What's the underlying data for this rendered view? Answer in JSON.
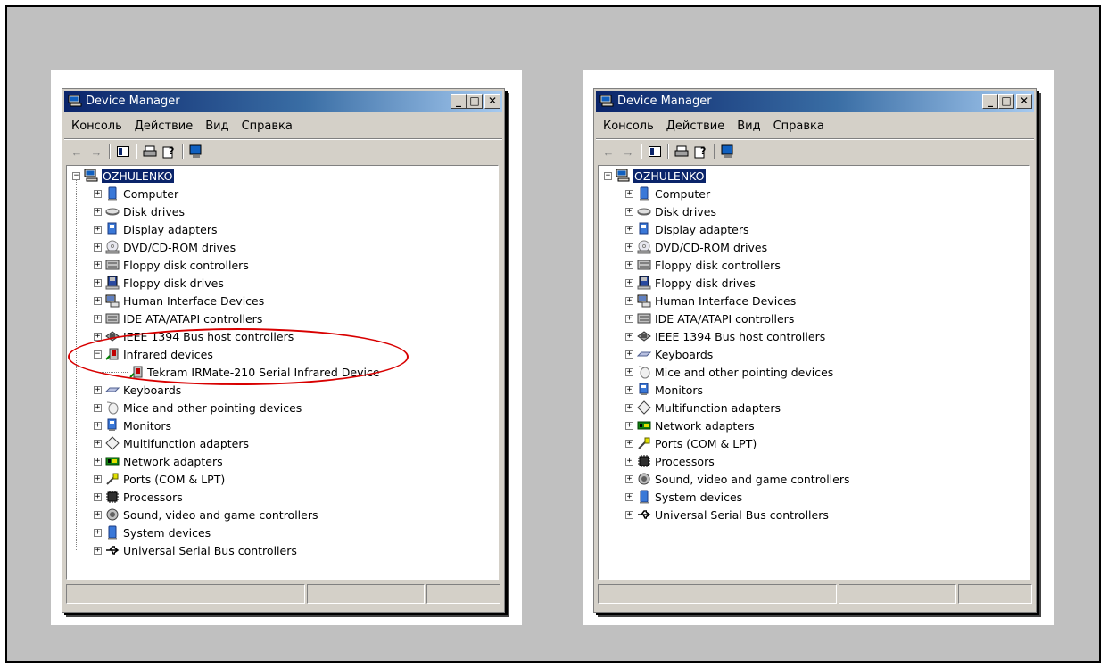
{
  "windows": [
    {
      "title": "Device Manager",
      "menu": [
        "Консоль",
        "Действие",
        "Вид",
        "Справка"
      ],
      "tree": {
        "root": "OZHULENKO",
        "items": [
          {
            "label": "Computer",
            "icon": "computer-icon"
          },
          {
            "label": "Disk drives",
            "icon": "disk-drive-icon"
          },
          {
            "label": "Display adapters",
            "icon": "display-adapter-icon"
          },
          {
            "label": "DVD/CD-ROM drives",
            "icon": "dvd-drive-icon"
          },
          {
            "label": "Floppy disk controllers",
            "icon": "controller-icon"
          },
          {
            "label": "Floppy disk drives",
            "icon": "floppy-drive-icon"
          },
          {
            "label": "Human Interface Devices",
            "icon": "hid-icon"
          },
          {
            "label": "IDE ATA/ATAPI controllers",
            "icon": "controller-icon"
          },
          {
            "label": "IEEE 1394 Bus host controllers",
            "icon": "ieee1394-icon"
          },
          {
            "label": "Infrared devices",
            "icon": "infrared-icon",
            "expanded": true,
            "children": [
              {
                "label": "Tekram IRMate-210 Serial Infrared Device",
                "icon": "infrared-icon"
              }
            ]
          },
          {
            "label": "Keyboards",
            "icon": "keyboard-icon"
          },
          {
            "label": "Mice and other pointing devices",
            "icon": "mouse-icon"
          },
          {
            "label": "Monitors",
            "icon": "monitor-icon"
          },
          {
            "label": "Multifunction adapters",
            "icon": "multifunction-icon"
          },
          {
            "label": "Network adapters",
            "icon": "network-adapter-icon"
          },
          {
            "label": "Ports (COM & LPT)",
            "icon": "port-icon"
          },
          {
            "label": "Processors",
            "icon": "processor-icon"
          },
          {
            "label": "Sound, video and game controllers",
            "icon": "sound-icon"
          },
          {
            "label": "System devices",
            "icon": "system-icon"
          },
          {
            "label": "Universal Serial Bus controllers",
            "icon": "usb-icon"
          }
        ]
      },
      "highlight": "infrared-devices"
    },
    {
      "title": "Device Manager",
      "menu": [
        "Консоль",
        "Действие",
        "Вид",
        "Справка"
      ],
      "tree": {
        "root": "OZHULENKO",
        "items": [
          {
            "label": "Computer",
            "icon": "computer-icon"
          },
          {
            "label": "Disk drives",
            "icon": "disk-drive-icon"
          },
          {
            "label": "Display adapters",
            "icon": "display-adapter-icon"
          },
          {
            "label": "DVD/CD-ROM drives",
            "icon": "dvd-drive-icon"
          },
          {
            "label": "Floppy disk controllers",
            "icon": "controller-icon"
          },
          {
            "label": "Floppy disk drives",
            "icon": "floppy-drive-icon"
          },
          {
            "label": "Human Interface Devices",
            "icon": "hid-icon"
          },
          {
            "label": "IDE ATA/ATAPI controllers",
            "icon": "controller-icon"
          },
          {
            "label": "IEEE 1394 Bus host controllers",
            "icon": "ieee1394-icon"
          },
          {
            "label": "Keyboards",
            "icon": "keyboard-icon"
          },
          {
            "label": "Mice and other pointing devices",
            "icon": "mouse-icon"
          },
          {
            "label": "Monitors",
            "icon": "monitor-icon"
          },
          {
            "label": "Multifunction adapters",
            "icon": "multifunction-icon"
          },
          {
            "label": "Network adapters",
            "icon": "network-adapter-icon"
          },
          {
            "label": "Ports (COM & LPT)",
            "icon": "port-icon"
          },
          {
            "label": "Processors",
            "icon": "processor-icon"
          },
          {
            "label": "Sound, video and game controllers",
            "icon": "sound-icon"
          },
          {
            "label": "System devices",
            "icon": "system-icon"
          },
          {
            "label": "Universal Serial Bus controllers",
            "icon": "usb-icon"
          }
        ]
      }
    }
  ]
}
